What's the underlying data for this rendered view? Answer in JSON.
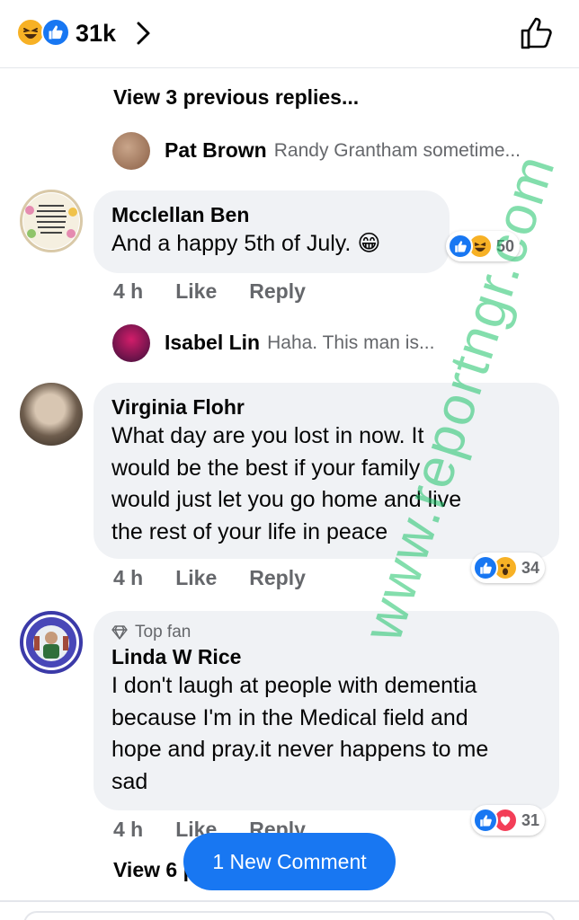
{
  "header": {
    "reaction_count": "31k",
    "reaction_icons": [
      "haha-reaction-icon",
      "like-reaction-icon"
    ]
  },
  "thread": {
    "view_previous": "View 3 previous replies...",
    "replies": [
      {
        "name": "Pat Brown",
        "preview": "Randy Grantham sometime..."
      },
      {
        "name": "Isabel Lin",
        "preview": "Haha.  This man is..."
      }
    ],
    "comments": [
      {
        "name": "Mcclellan Ben",
        "text": [
          "And a happy 5th of July. 😁"
        ],
        "time": "4 h",
        "like": "Like",
        "reply": "Reply",
        "reactions": {
          "icons": [
            "like",
            "haha"
          ],
          "count": "50"
        }
      },
      {
        "name": "Virginia Flohr",
        "text": [
          "What  day are you lost in now.  It",
          "would be the best if your family",
          "would just let you go home and  live",
          "the rest of your life in peace"
        ],
        "time": "4 h",
        "like": "Like",
        "reply": "Reply",
        "reactions": {
          "icons": [
            "like",
            "wow"
          ],
          "count": "34"
        }
      },
      {
        "badge": "Top fan",
        "name": "Linda W Rice",
        "text": [
          "I don't laugh at people with dementia",
          "because I'm in the Medical field and",
          "hope and pray.it never happens to me",
          "sad"
        ],
        "time": "4 h",
        "like": "Like",
        "reply": "Reply",
        "reactions": {
          "icons": [
            "like",
            "love"
          ],
          "count": "31"
        }
      }
    ],
    "view_more": "View 6 previous replies..."
  },
  "new_comment_button": "1 New Comment",
  "watermark": "www.reportngr.com",
  "colors": {
    "accent": "#1877f2",
    "bubble": "#f0f2f5",
    "muted": "#65676b",
    "watermark": "#1ec46a"
  }
}
